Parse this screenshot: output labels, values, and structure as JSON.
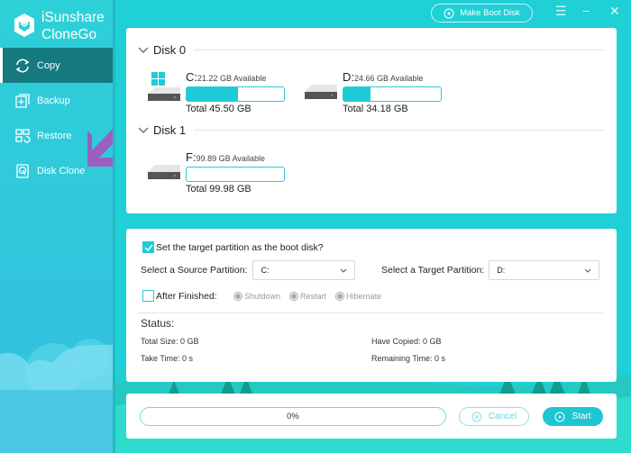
{
  "app": {
    "brand_line1": "iSunshare",
    "brand_line2": "CloneGo"
  },
  "sidebar": {
    "items": [
      {
        "label": "Copy",
        "icon": "sync-icon",
        "active": true
      },
      {
        "label": "Backup",
        "icon": "backup-icon",
        "active": false
      },
      {
        "label": "Restore",
        "icon": "restore-icon",
        "active": false
      },
      {
        "label": "Disk Clone",
        "icon": "disk-clone-icon",
        "active": false
      }
    ]
  },
  "topbar": {
    "make_boot_disk": "Make Boot Disk",
    "menu_icon": "☰",
    "minimize_icon": "−",
    "close_icon": "✕"
  },
  "disks": [
    {
      "label": "Disk 0",
      "partitions": [
        {
          "letter": "C:",
          "available": "21.22 GB Available",
          "total": "Total 45.50 GB",
          "used_fraction": 0.53,
          "system": true
        },
        {
          "letter": "D:",
          "available": "24.66 GB Available",
          "total": "Total 34.18 GB",
          "used_fraction": 0.28,
          "system": false
        }
      ]
    },
    {
      "label": "Disk 1",
      "partitions": [
        {
          "letter": "F:",
          "available": "99.89 GB Available",
          "total": "Total 99.98 GB",
          "used_fraction": 0.0,
          "system": false
        }
      ]
    }
  ],
  "options": {
    "boot_checkbox_label": "Set the target partition as the boot disk?",
    "boot_checked": true,
    "source_label": "Select a Source Partition:",
    "source_value": "C:",
    "target_label": "Select a Target Partition:",
    "target_value": "D:",
    "after_finished_label": "After Finished:",
    "after_finished_checked": false,
    "radios": [
      "Shutdown",
      "Restart",
      "Hibernate"
    ]
  },
  "status": {
    "title": "Status:",
    "total_size": "Total Size: 0 GB",
    "have_copied": "Have Copied: 0 GB",
    "take_time": "Take Time: 0 s",
    "remaining_time": "Remaining Time: 0 s"
  },
  "progress": {
    "percent_label": "0%",
    "value": 0,
    "cancel_label": "Cancel",
    "start_label": "Start"
  },
  "colors": {
    "accent": "#1ecbd6",
    "sidebar_active": "#157a80",
    "arrow": "#9b5fc0"
  }
}
